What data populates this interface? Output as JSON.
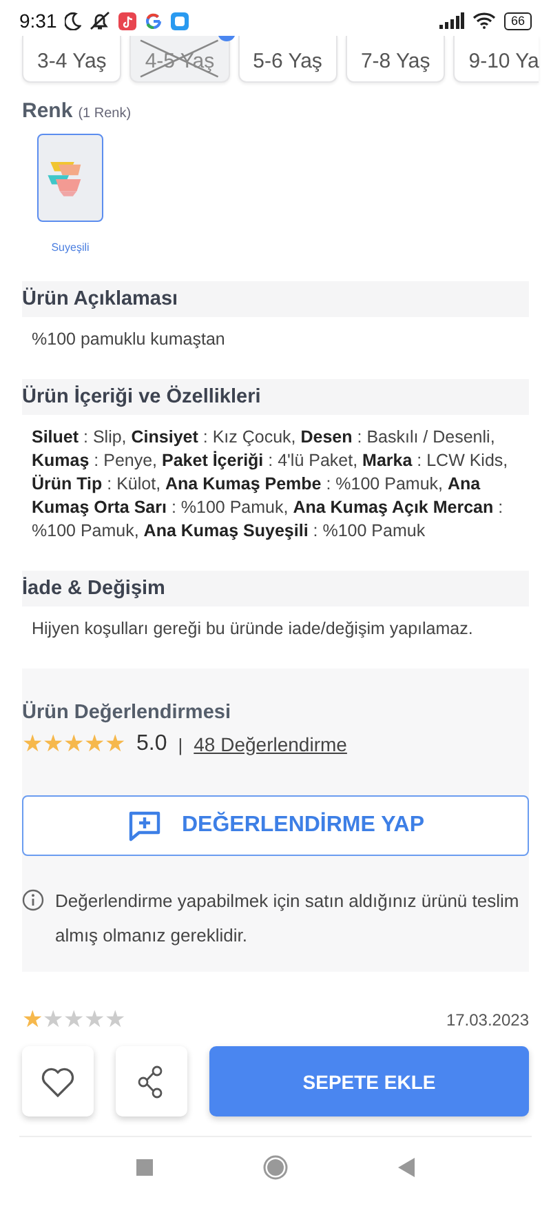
{
  "status_bar": {
    "time": "9:31",
    "battery": "66"
  },
  "sizes": [
    {
      "label": "3-4 Yaş",
      "disabled": false
    },
    {
      "label": "4-5 Yaş",
      "disabled": true
    },
    {
      "label": "5-6 Yaş",
      "disabled": false
    },
    {
      "label": "7-8 Yaş",
      "disabled": false
    },
    {
      "label": "9-10 Ya",
      "disabled": false
    }
  ],
  "color_section": {
    "title": "Renk",
    "count": "(1 Renk)",
    "swatches": [
      {
        "label": "Suyeşili",
        "selected": true,
        "kind": "picture"
      }
    ]
  },
  "sections": [
    {
      "title": "Ürün Açıklaması",
      "text": "%100 pamuklu kumaştan"
    },
    {
      "title": "Ürün İçeriği ve Özellikleri",
      "text": "**Siluet** : Slip, **Cinsiyet** : Kız Çocuk, **Desen** : Baskılı / Desenli, **Kumaş** : Penye, **Paket İçeriği** : 4'lü Paket, **Marka** : LCW Kids, **Ürün Tip** : Külot, **Ana Kumaş Pembe** : %100 Pamuk, **Ana Kumaş Orta Sarı** : %100 Pamuk, **Ana Kumaş Açık Mercan** : %100 Pamuk, **Ana Kumaş Suyeşili** : %100 Pamuk"
    },
    {
      "title": "İade & Değişim",
      "text": "Hijyen koşulları gereği bu üründe iade/değişim yapılamaz."
    }
  ],
  "reviews": {
    "title": "Ürün Değerlendirmesi",
    "stars": 5,
    "score": "5.0",
    "separator": "|",
    "count_link": "48 Değerlendirme",
    "write_button": "DEĞERLENDİRME YAP",
    "info": "Değerlendirme yapabilmek için satın aldığınız ürünü teslim almış olmanız gereklidir."
  },
  "review": {
    "stars": 1,
    "date": "17.03.2023"
  },
  "bottom_bar": {
    "add_to_cart": "SEPETE EKLE"
  }
}
